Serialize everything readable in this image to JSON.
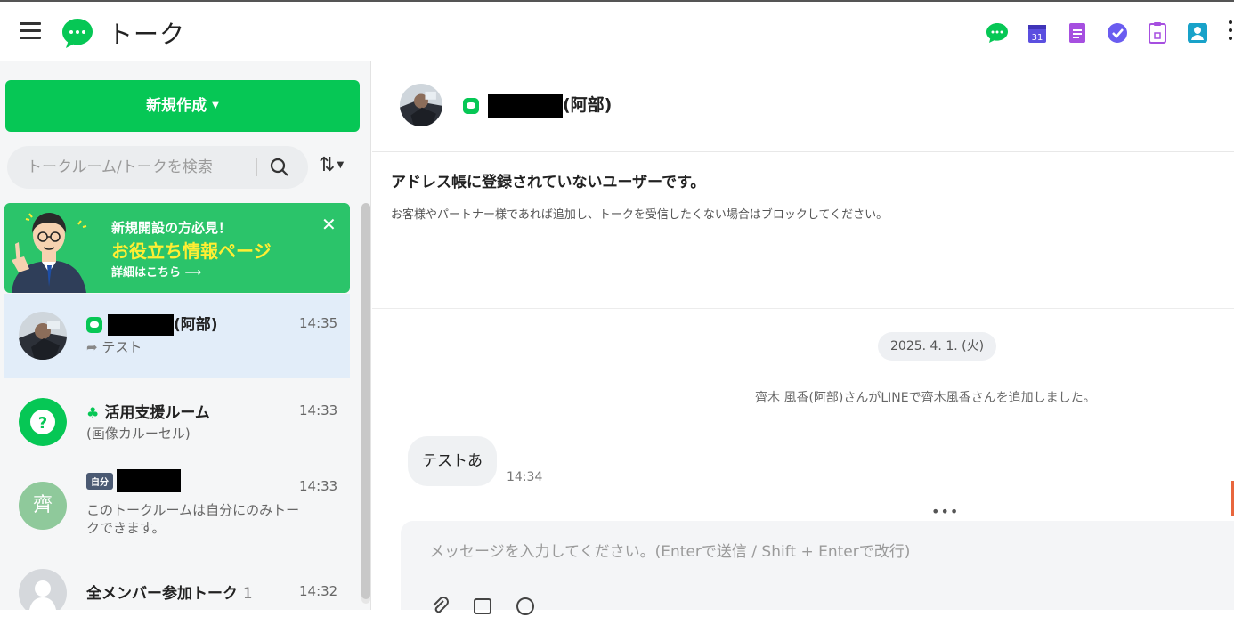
{
  "topbar": {
    "title": "トーク",
    "apps": [
      "talk-app-icon",
      "calendar-app-icon",
      "note-app-icon",
      "task-app-icon",
      "clipboard-app-icon",
      "contacts-app-icon"
    ],
    "calendar_day": "31"
  },
  "sidebar": {
    "new_button": "新規作成",
    "search_placeholder": "トークルーム/トークを検索",
    "banner": {
      "subtitle": "新規開設の方必見！",
      "title": "お役立ち情報ページ",
      "link": "詳細はこちら ⟶"
    },
    "chats": [
      {
        "name_suffix": "(阿部)",
        "time": "14:35",
        "preview": "テスト"
      },
      {
        "name": "活用支援ルーム",
        "time": "14:33",
        "preview": "(画像カルーセル)"
      },
      {
        "badge": "自分",
        "time": "14:33",
        "preview": "このトークルームは自分にのみトークできます。"
      },
      {
        "name": "全メンバー参加トーク",
        "count": "1",
        "time": "14:32"
      }
    ],
    "avatar_letter": "齊"
  },
  "main": {
    "header_name_suffix": "(阿部)",
    "notice_title": "アドレス帳に登録されていないユーザーです。",
    "notice_body": "お客様やパートナー様であれば追加し、トークを受信したくない場合はブロックしてください。",
    "date": "2025. 4. 1. (火)",
    "system_message": "齊木 風香(阿部)さんがLINEで齊木風香さんを追加しました。",
    "message": {
      "text": "テストあ",
      "time": "14:34"
    },
    "composer_dots": "•••",
    "composer_placeholder": "メッセージを入力してください。(Enterで送信 / Shift + Enterで改行)"
  },
  "colors": {
    "accent": "#06c755",
    "banner": "#2bc46a",
    "active_row": "#e2edf9"
  }
}
